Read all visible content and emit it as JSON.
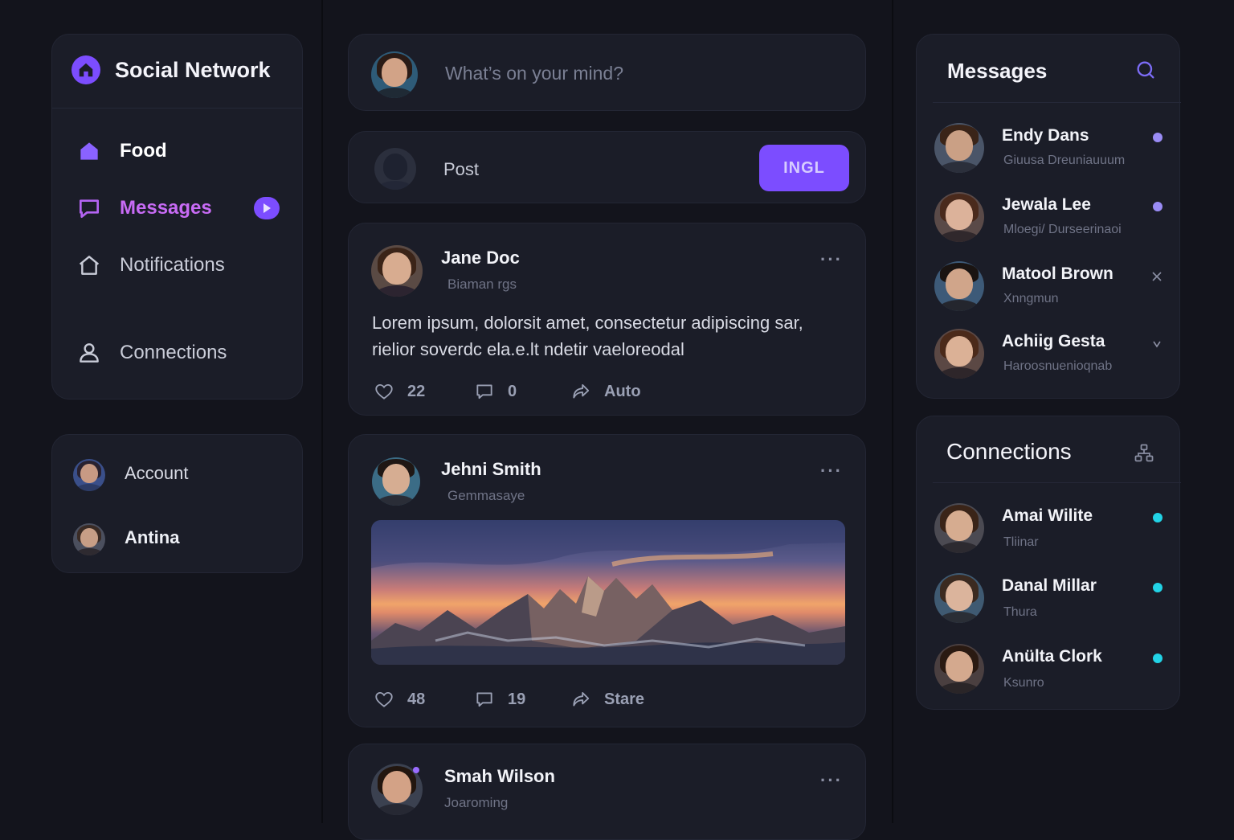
{
  "app": {
    "title": "Social Network"
  },
  "sidebar": {
    "items": [
      {
        "label": "Food",
        "icon": "home-icon"
      },
      {
        "label": "Messages",
        "icon": "chat-bubble-icon"
      },
      {
        "label": "Notifications",
        "icon": "house-outline-icon"
      },
      {
        "label": "Connections",
        "icon": "user-icon"
      }
    ],
    "accounts": [
      {
        "label": "Account"
      },
      {
        "label": "Antina"
      }
    ]
  },
  "composer": {
    "placeholder": "What’s on your mind?",
    "post_label": "Post",
    "button_label": "INGL"
  },
  "feed": {
    "posts": [
      {
        "author": "Jane Doc",
        "subtitle": "Biaman rgs",
        "text": "Lorem ipsum, dolorsit amet, consectetur adipiscing sar, rielior soverdc ela.e.lt ndetir vaeloreodal",
        "likes": "22",
        "comments": "0",
        "share": "Auto"
      },
      {
        "author": "Jehni Smith",
        "subtitle": "Gemmasaye",
        "likes": "48",
        "comments": "19",
        "share": "Stare"
      },
      {
        "author": "Smah Wilson",
        "subtitle": "Joaroming"
      }
    ]
  },
  "messages": {
    "title": "Messages",
    "items": [
      {
        "name": "Endy Dans",
        "preview": "Giuusa Dreuniauuum"
      },
      {
        "name": "Jewala Lee",
        "preview": "Mloegi/ Durseerinaoi"
      },
      {
        "name": "Matool Brown",
        "preview": "Xnngmun"
      },
      {
        "name": "Achiig Gesta",
        "preview": "Haroosnuenioqnab"
      }
    ]
  },
  "connections": {
    "title": "Connections",
    "items": [
      {
        "name": "Amai Wilite",
        "status": "Tliinar"
      },
      {
        "name": "Danal Millar",
        "status": "Thura"
      },
      {
        "name": "Anülta Clork",
        "status": "Ksunro"
      }
    ]
  },
  "colors": {
    "accent": "#7c4dff",
    "accent_pink": "#c86bf5",
    "online_cyan": "#22d3e6",
    "unread_purple": "#9a8cf5"
  }
}
